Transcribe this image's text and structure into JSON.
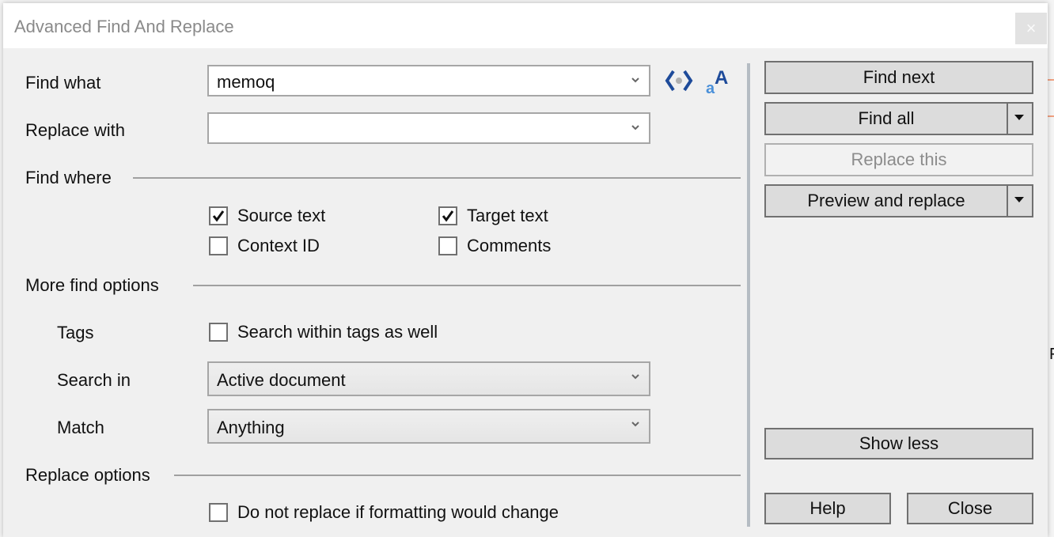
{
  "window": {
    "title": "Advanced Find And Replace",
    "close_glyph": "×"
  },
  "find_what": {
    "label": "Find what",
    "value": "memoq"
  },
  "replace_with": {
    "label": "Replace with",
    "value": ""
  },
  "toolbar_icons": [
    {
      "name": "regex-tags-icon",
      "tooltip": ""
    },
    {
      "name": "match-case-icon",
      "tooltip": ""
    }
  ],
  "find_where": {
    "heading": "Find where",
    "options": [
      {
        "label": "Source text",
        "checked": true
      },
      {
        "label": "Target text",
        "checked": true
      },
      {
        "label": "Context ID",
        "checked": false
      },
      {
        "label": "Comments",
        "checked": false
      }
    ]
  },
  "more_find_options": {
    "heading": "More find options",
    "tags": {
      "label": "Tags",
      "checkbox_label": "Search within tags as well",
      "checked": false
    },
    "search_in": {
      "label": "Search in",
      "value": "Active document"
    },
    "match": {
      "label": "Match",
      "value": "Anything"
    }
  },
  "replace_options": {
    "heading": "Replace options",
    "checkbox_label": "Do not replace if formatting would change",
    "checked": false
  },
  "buttons": {
    "find_next": "Find next",
    "find_all": "Find all",
    "replace_this": "Replace this",
    "preview_and_replace": "Preview and replace",
    "show_less": "Show less",
    "help": "Help",
    "close": "Close"
  },
  "colors": {
    "icon_blue_dark": "#1e4b9a",
    "icon_blue_light": "#4a90d9",
    "background_app_accent": "#f08a5d"
  },
  "background": {
    "partial_text": "F"
  }
}
